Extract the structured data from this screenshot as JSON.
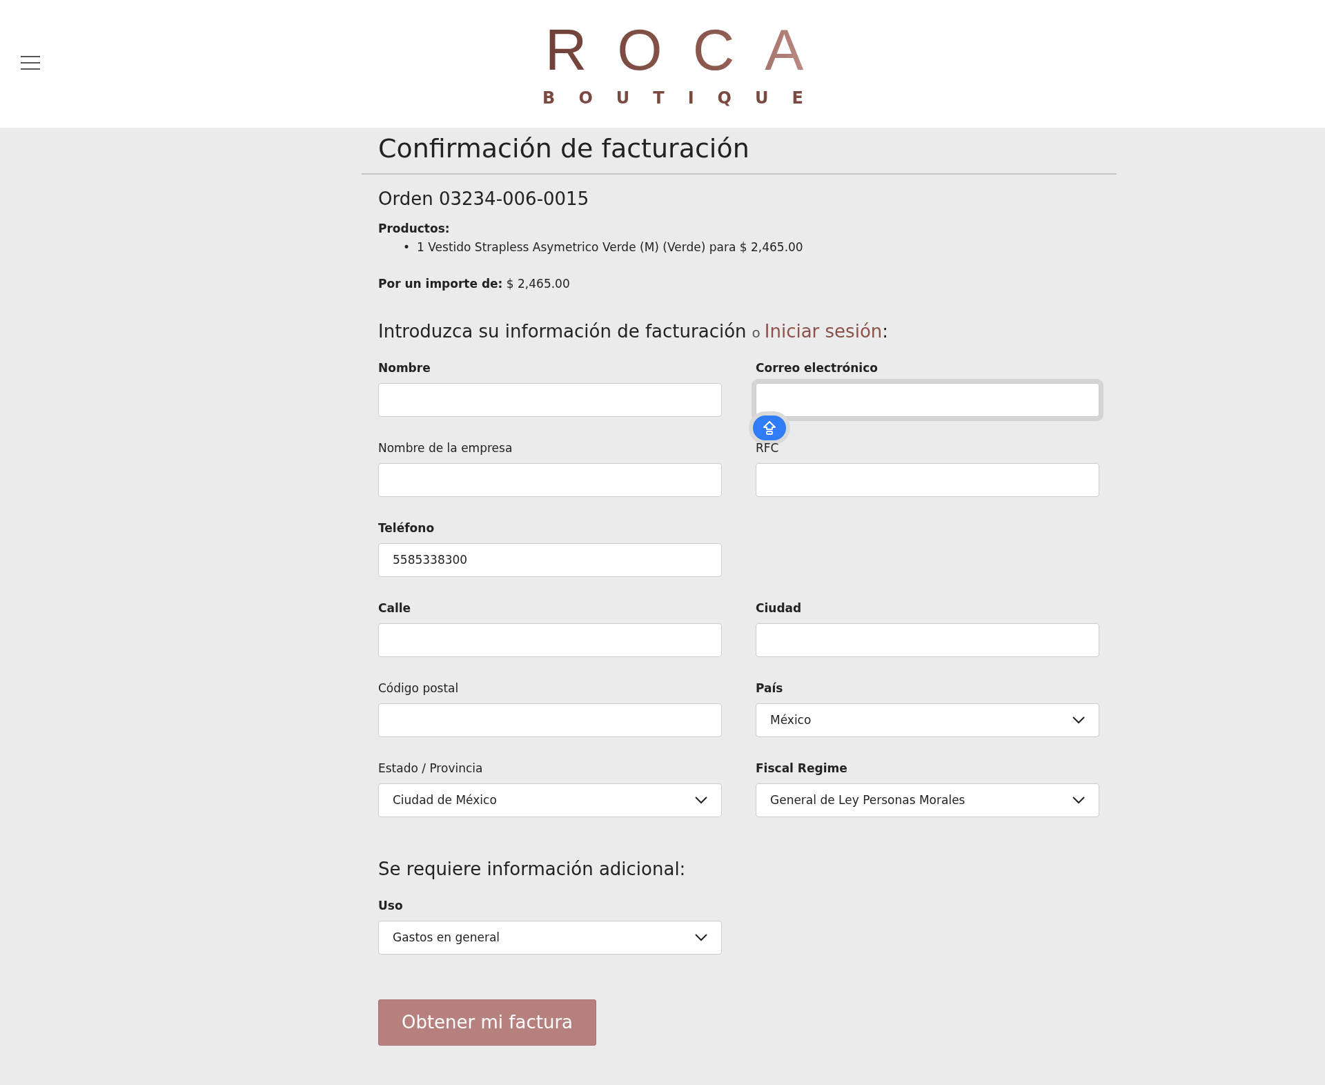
{
  "header": {
    "logo": {
      "word": "ROCA",
      "subword": "BOUTIQUE"
    }
  },
  "page": {
    "title": "Confirmación de facturación"
  },
  "order": {
    "title": "Orden 03234-006-0015",
    "products_label": "Productos:",
    "products": [
      {
        "bullet": "•",
        "text": "1 Vestido Strapless Asymetrico Verde (M) (Verde) para $ 2,465.00"
      }
    ],
    "amount_label": "Por un importe de:",
    "amount": "$ 2,465.00"
  },
  "billing": {
    "heading": "Introduzca su información de facturación",
    "or": "o",
    "login_link": "Iniciar sesión",
    "colon": ":",
    "rows": [
      [
        {
          "label": "Nombre",
          "kind": "text",
          "required": true,
          "focused": false
        },
        {
          "label": "Correo electrónico",
          "kind": "text",
          "required": true,
          "focused": true
        }
      ],
      [
        {
          "label": "Nombre de la empresa",
          "kind": "text",
          "required": false,
          "focused": false
        },
        {
          "label": "RFC",
          "kind": "text",
          "required": false,
          "focused": false
        }
      ],
      [
        {
          "label": "Teléfono",
          "kind": "text",
          "required": true,
          "focused": false,
          "value": "5585338300"
        }
      ],
      [
        {
          "label": "Calle",
          "kind": "text",
          "required": true,
          "focused": false
        },
        {
          "label": "Ciudad",
          "kind": "text",
          "required": true,
          "focused": false
        }
      ],
      [
        {
          "label": "Código postal",
          "kind": "text",
          "required": false,
          "focused": false
        },
        {
          "label": "País",
          "kind": "select",
          "required": true,
          "value": "México"
        }
      ],
      [
        {
          "label": "Estado / Provincia",
          "kind": "select",
          "required": false,
          "value": "Ciudad de México"
        },
        {
          "label": "Fiscal Regime",
          "kind": "select",
          "required": true,
          "value": "General de Ley Personas Morales"
        }
      ]
    ]
  },
  "additional": {
    "heading": "Se requiere información adicional:",
    "fields": [
      {
        "label": "Uso",
        "kind": "select",
        "required": true,
        "value": "Gastos en general"
      }
    ]
  },
  "submit": {
    "label": "Obtener mi factura"
  }
}
